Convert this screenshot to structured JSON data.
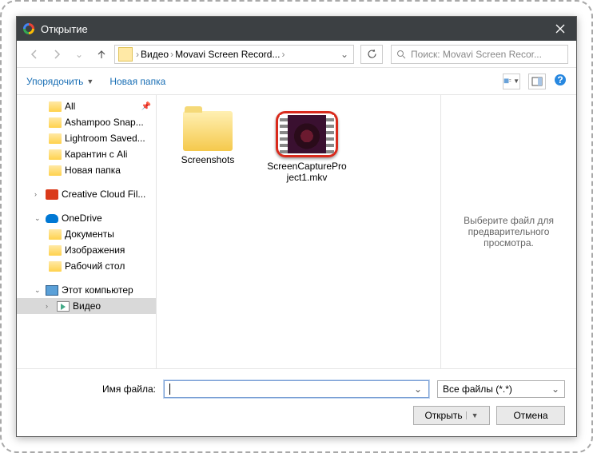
{
  "titlebar": {
    "title": "Открытие"
  },
  "breadcrumb": {
    "parts": [
      "Видео",
      "Movavi Screen Record..."
    ]
  },
  "search": {
    "placeholder": "Поиск: Movavi Screen Recor..."
  },
  "toolbar": {
    "organize": "Упорядочить",
    "newfolder": "Новая папка"
  },
  "tree": {
    "all": "All",
    "ashampoo": "Ashampoo Snap...",
    "lightroom": "Lightroom Saved...",
    "karantin": "Карантин с Ali",
    "novaya": "Новая папка",
    "creative": "Creative Cloud Fil...",
    "onedrive": "OneDrive",
    "documents": "Документы",
    "images": "Изображения",
    "desktop": "Рабочий стол",
    "thispc": "Этот компьютер",
    "video": "Видео"
  },
  "files": {
    "screenshots": "Screenshots",
    "capture": "ScreenCaptureProject1.mkv"
  },
  "preview": {
    "text": "Выберите файл для предварительного просмотра."
  },
  "footer": {
    "filename_label": "Имя файла:",
    "filename_value": "",
    "filter": "Все файлы (*.*)",
    "open": "Открыть",
    "cancel": "Отмена"
  }
}
